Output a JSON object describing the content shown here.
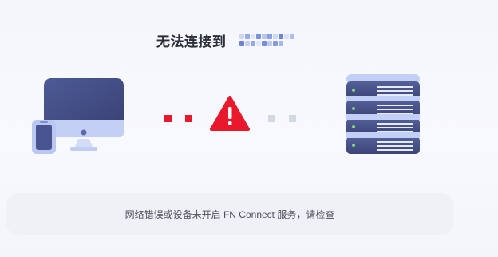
{
  "header": {
    "title": "无法连接到",
    "device_name_obscured": true
  },
  "illustration": {
    "left_device_icons": [
      "monitor-icon",
      "phone-icon"
    ],
    "status_icon": "warning-triangle-icon",
    "right_device_icon": "server-icon",
    "error_color": "#e8192c",
    "idle_dot_color": "#d3d9e3"
  },
  "message": {
    "text": "网络错误或设备未开启 FN Connect 服务，请检查"
  },
  "colors": {
    "device_primary": "#46508a",
    "device_light": "#b8c6f2",
    "background": "#f4f6fb"
  }
}
